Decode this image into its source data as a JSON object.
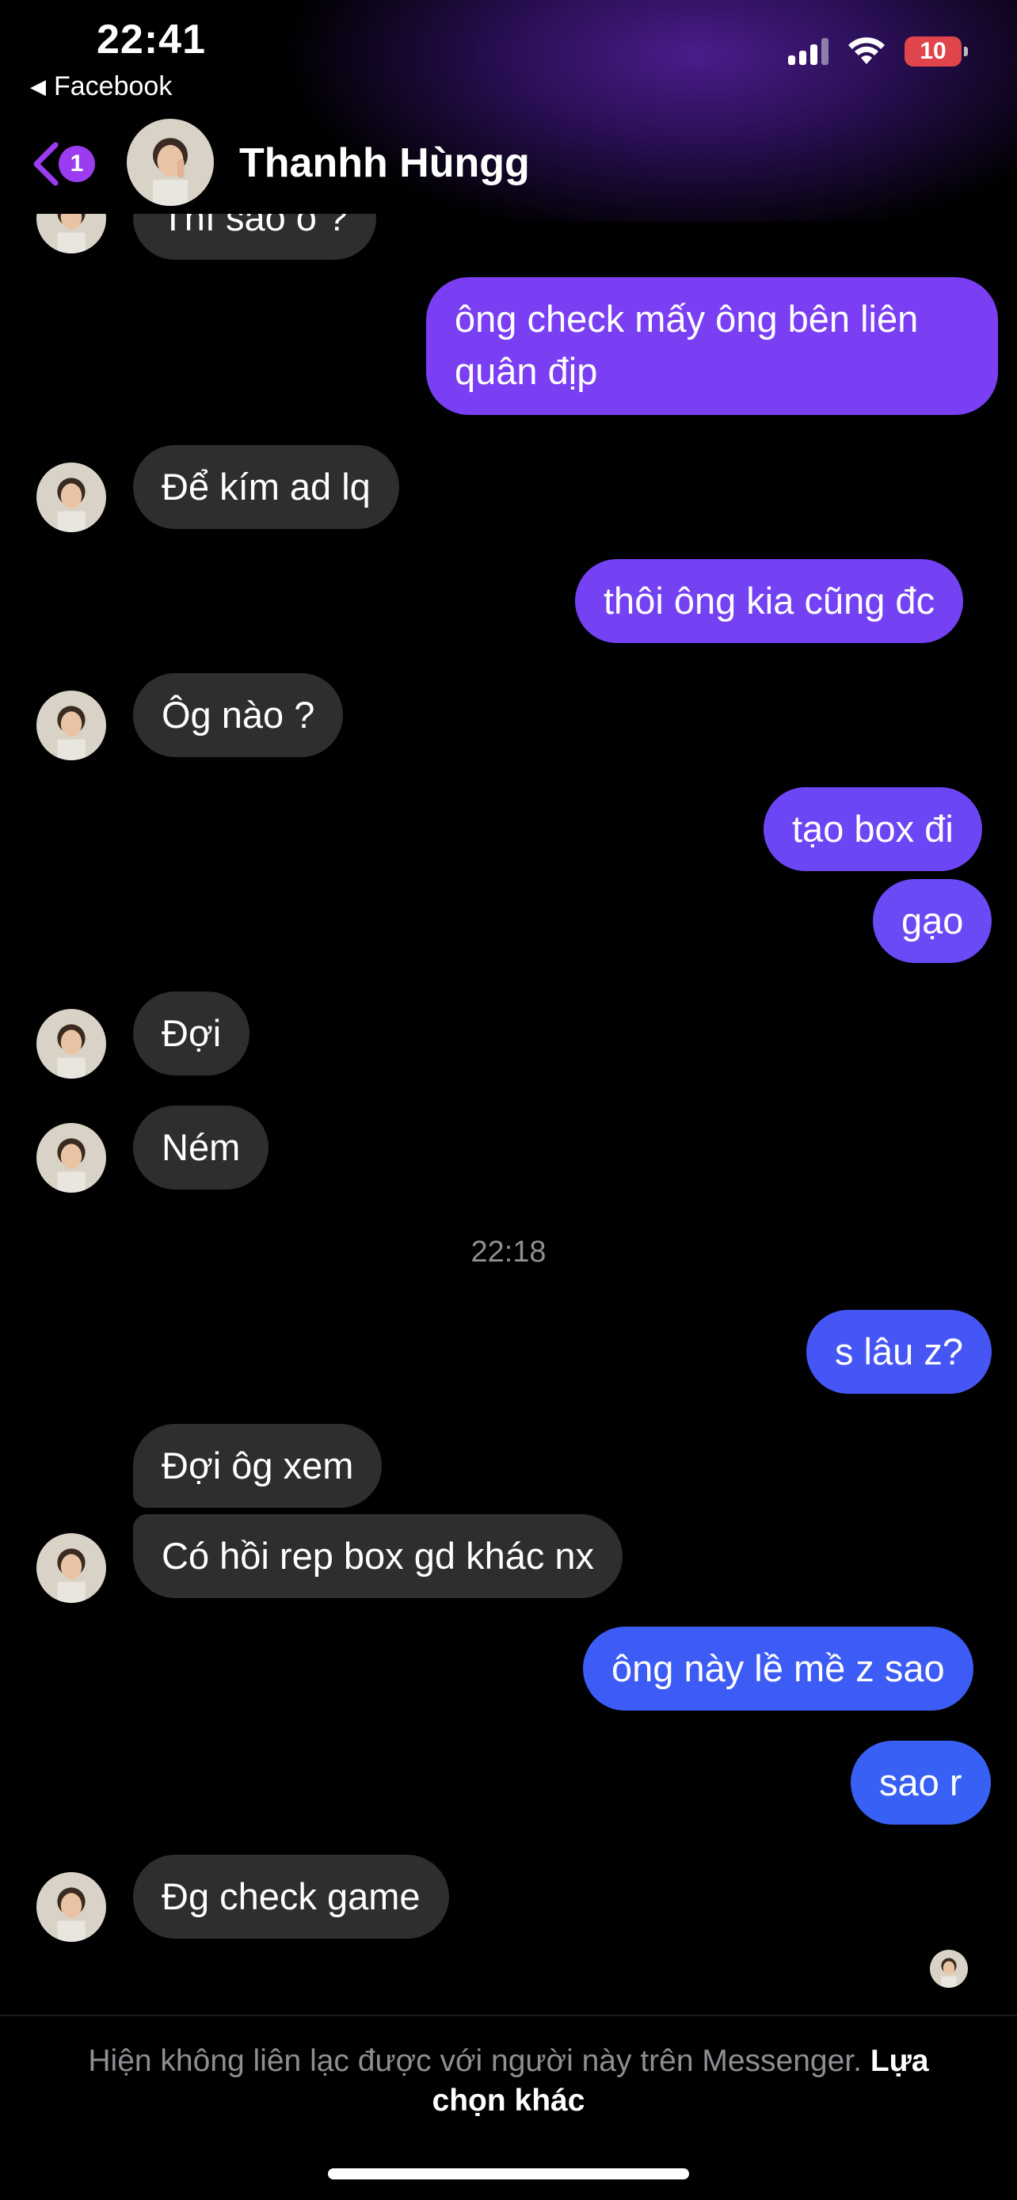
{
  "status_bar": {
    "time": "22:41",
    "back_app": "Facebook",
    "battery": "10",
    "icons": [
      "signal-icon",
      "wifi-icon",
      "battery-icon"
    ]
  },
  "header": {
    "unread_count": "1",
    "contact_name": "Thanhh Hùngg"
  },
  "messages": {
    "partial_top": "Thì sao ô ?",
    "m1": "ông check mấy ông bên liên",
    "m1b": "quân địp",
    "m2": "Để kím ad lq",
    "m3": "thôi ông kia cũng đc",
    "m4": "Ôg nào ?",
    "m5": "tạo box đi",
    "m6": "gạo",
    "m7": "Đợi",
    "m8": "Ném",
    "m9": "s lâu z?",
    "m10": "Đợi ôg xem",
    "m11": "Có hồi rep box gd khác nx",
    "m12": "ông này lề mề z sao",
    "m13": "sao r",
    "m14": "Đg check game"
  },
  "timestamp": "22:18",
  "footer": {
    "notice": "Hiện không liên lạc được với người này trên Messenger.",
    "action": "Lựa chọn khác"
  },
  "colors": {
    "purple_bubble": "#7a3ff2",
    "violet_bubble": "#6a4af5",
    "blue_bubble": "#3a5cf5",
    "incoming_bubble": "#2e2e2e",
    "badge": "#9b3cf0"
  }
}
